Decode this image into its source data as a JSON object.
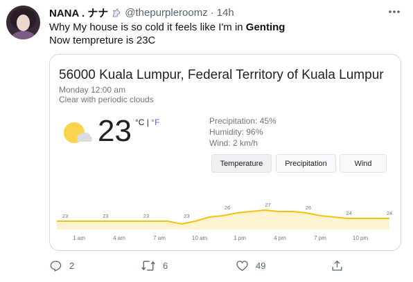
{
  "tweet": {
    "display_name": "NANA . ナナ",
    "badge_icon": "unicorn-icon",
    "handle": "@thepurpleroomz",
    "separator": "·",
    "time": "14h",
    "text_line1_prefix": "Why My house is so cold it feels like I'm in ",
    "text_line1_bold": "Genting",
    "text_line2": "Now tempreture is 23C",
    "more_icon": "more-icon"
  },
  "weather_card": {
    "location": "56000 Kuala Lumpur, Federal Territory of Kuala Lumpur",
    "datetime": "Monday 12:00 am",
    "condition": "Clear with periodic clouds",
    "condition_icon": "partly-cloudy-icon",
    "temperature": "23",
    "unit_c": "°C",
    "unit_sep": " | ",
    "unit_f": "°F",
    "precipitation": "Precipitation: 45%",
    "humidity": "Humidity: 96%",
    "wind": "Wind: 2 km/h",
    "tabs": [
      {
        "label": "Temperature",
        "active": true
      },
      {
        "label": "Precipitation",
        "active": false
      },
      {
        "label": "Wind",
        "active": false
      }
    ],
    "line_color": "#f4c20d",
    "fill_color": "#fdf3d1"
  },
  "chart_data": {
    "type": "area",
    "x": [
      "1 am",
      "4 am",
      "7 am",
      "10 am",
      "1 pm",
      "4 pm",
      "7 pm",
      "10 pm"
    ],
    "value_labels": [
      {
        "x": "1 am",
        "y": 23
      },
      {
        "x": "4 am",
        "y": 23
      },
      {
        "x": "7 am",
        "y": 23
      },
      {
        "x": "10 am",
        "y": 23
      },
      {
        "x": "1 pm",
        "y": 26
      },
      {
        "x": "4 pm",
        "y": 27
      },
      {
        "x": "7 pm",
        "y": 26
      },
      {
        "x": "10 pm",
        "y": 24
      },
      {
        "x": "end",
        "y": 24
      }
    ],
    "curve": [
      23,
      23,
      23,
      23,
      23,
      23,
      23,
      23,
      23,
      22,
      23,
      24.5,
      25,
      26,
      26.5,
      27,
      26.5,
      26.5,
      26,
      25,
      24.5,
      24,
      24,
      24,
      24
    ],
    "ylim": [
      20,
      29
    ]
  },
  "actions": {
    "reply_count": "2",
    "retweet_count": "6",
    "like_count": "49",
    "reply_icon": "reply-icon",
    "retweet_icon": "retweet-icon",
    "like_icon": "heart-icon",
    "share_icon": "share-icon"
  }
}
